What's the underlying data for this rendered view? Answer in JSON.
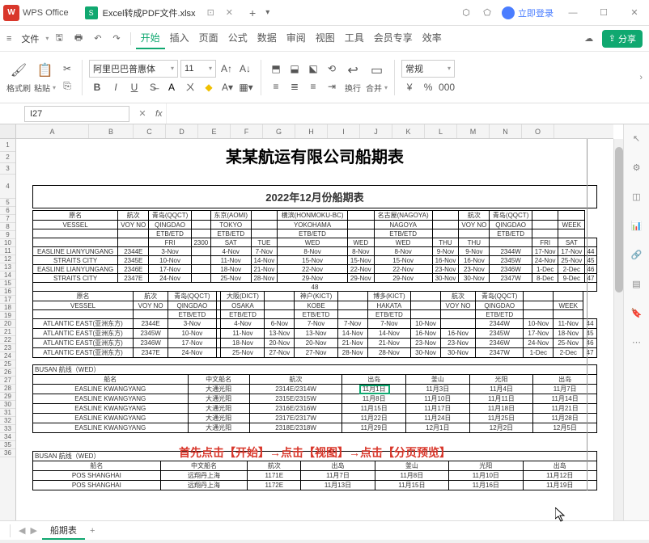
{
  "app": {
    "name": "WPS Office",
    "file_name": "Excel转成PDF文件.xlsx"
  },
  "login": {
    "label": "立即登录"
  },
  "menu": {
    "file": "文件",
    "tabs": [
      "开始",
      "插入",
      "页面",
      "公式",
      "数据",
      "审阅",
      "视图",
      "工具",
      "会员专享",
      "效率"
    ],
    "active": 0
  },
  "share": {
    "label": "分享"
  },
  "ribbon": {
    "format_painter": "格式刷",
    "paste": "粘贴",
    "font": "阿里巴巴普惠体",
    "font_size": "11",
    "wrap": "换行",
    "merge": "合并",
    "normal": "常规"
  },
  "formula": {
    "name_box": "I27",
    "fx": "fx"
  },
  "cols": [
    "A",
    "B",
    "C",
    "D",
    "E",
    "F",
    "G",
    "H",
    "I",
    "J",
    "K",
    "L",
    "M",
    "N",
    "O"
  ],
  "rows_start": 1,
  "rows_end": 36,
  "doc": {
    "title": "某某航运有限公司船期表",
    "subtitle": "2022年12月份船期表"
  },
  "tbl1": {
    "hdr1": [
      "原名",
      "航次",
      "青岛(QQCT)",
      "",
      "东京(AOMI)",
      "",
      "横滨(HONMOKU-BC)",
      "",
      "名古屋(NAGOYA)",
      "",
      "航次",
      "青岛(QQCT)",
      "",
      ""
    ],
    "hdr2": [
      "VESSEL",
      "VOY NO",
      "QINGDAO",
      "",
      "TOKYO",
      "",
      "YOKOHAMA",
      "",
      "NAGOYA",
      "",
      "VOY NO",
      "QINGDAO",
      "",
      "WEEK"
    ],
    "hdr3": [
      "",
      "",
      "ETB/ETD",
      "",
      "ETB/ETD",
      "",
      "ETB/ETD",
      "",
      "ETB/ETD",
      "",
      "",
      "ETB/ETD",
      "",
      ""
    ],
    "hdr4": [
      "",
      "",
      "FRI",
      "2300",
      "SAT",
      "TUE",
      "WED",
      "WED",
      "WED",
      "THU",
      "THU",
      "",
      "FRI",
      "SAT",
      ""
    ],
    "rows": [
      [
        "EASLINE LIANYUNGANG",
        "2344E",
        "3-Nov",
        "",
        "4-Nov",
        "7-Nov",
        "8-Nov",
        "8-Nov",
        "8-Nov",
        "9-Nov",
        "9-Nov",
        "2344W",
        "17-Nov",
        "17-Nov",
        "44"
      ],
      [
        "STRAITS CITY",
        "2345E",
        "10-Nov",
        "",
        "11-Nov",
        "14-Nov",
        "15-Nov",
        "15-Nov",
        "15-Nov",
        "16-Nov",
        "16-Nov",
        "2345W",
        "24-Nov",
        "25-Nov",
        "45"
      ],
      [
        "EASLINE LIANYUNGANG",
        "2346E",
        "17-Nov",
        "",
        "18-Nov",
        "21-Nov",
        "22-Nov",
        "22-Nov",
        "22-Nov",
        "23-Nov",
        "23-Nov",
        "2346W",
        "1-Dec",
        "2-Dec",
        "46"
      ],
      [
        "STRAITS CITY",
        "2347E",
        "24-Nov",
        "",
        "25-Nov",
        "28-Nov",
        "29-Nov",
        "29-Nov",
        "29-Nov",
        "30-Nov",
        "30-Nov",
        "2347W",
        "8-Dec",
        "9-Dec",
        "47"
      ]
    ],
    "footer_num": "48"
  },
  "tbl2": {
    "hdr1": [
      "原名",
      "航次",
      "青岛(QQCT)",
      "",
      "大阪(DICT)",
      "",
      "神户(KICT)",
      "",
      "博多(KICT)",
      "",
      "航次",
      "青岛(QQCT)",
      "",
      ""
    ],
    "hdr2": [
      "VESSEL",
      "VOY NO",
      "QINGDAO",
      "",
      "OSAKA",
      "",
      "KOBE",
      "",
      "HAKATA",
      "",
      "VOY NO",
      "QINGDAO",
      "",
      "WEEK"
    ],
    "hdr3": [
      "",
      "",
      "ETB/ETD",
      "",
      "ETB/ETD",
      "",
      "ETB/ETD",
      "",
      "ETB/ETD",
      "",
      "",
      "ETB/ETD",
      "",
      ""
    ],
    "rows": [
      [
        "ATLANTIC EAST(亚洲东方)",
        "2344E",
        "3-Nov",
        "",
        "4-Nov",
        "6-Nov",
        "7-Nov",
        "7-Nov",
        "7-Nov",
        "10-Nov",
        "",
        "2344W",
        "10-Nov",
        "11-Nov",
        "44"
      ],
      [
        "ATLANTIC EAST(亚洲东方)",
        "2345W",
        "10-Nov",
        "",
        "11-Nov",
        "13-Nov",
        "13-Nov",
        "14-Nov",
        "14-Nov",
        "16-Nov",
        "16-Nov",
        "2345W",
        "17-Nov",
        "18-Nov",
        "45"
      ],
      [
        "ATLANTIC EAST(亚洲东方)",
        "2346W",
        "17-Nov",
        "",
        "18-Nov",
        "20-Nov",
        "20-Nov",
        "21-Nov",
        "21-Nov",
        "23-Nov",
        "23-Nov",
        "2346W",
        "24-Nov",
        "25-Nov",
        "46"
      ],
      [
        "ATLANTIC EAST(亚洲东方)",
        "2347E",
        "24-Nov",
        "",
        "25-Nov",
        "27-Nov",
        "27-Nov",
        "28-Nov",
        "28-Nov",
        "30-Nov",
        "30-Nov",
        "2347W",
        "1-Dec",
        "2-Dec",
        "47"
      ]
    ]
  },
  "tbl3": {
    "title": "BUSAN 航线（WED）",
    "hdr": [
      "船名",
      "中文船名",
      "航次",
      "出岛",
      "釜山",
      "光阳",
      "出岛"
    ],
    "rows": [
      [
        "EASLINE KWANGYANG",
        "大通光阳",
        "2314E/2314W",
        "11月1日",
        "11月3日",
        "11月4日",
        "11月7日"
      ],
      [
        "EASLINE KWANGYANG",
        "大通光阳",
        "2315E/2315W",
        "11月8日",
        "11月10日",
        "11月11日",
        "11月14日"
      ],
      [
        "EASLINE KWANGYANG",
        "大通光阳",
        "2316E/2316W",
        "11月15日",
        "11月17日",
        "11月18日",
        "11月21日"
      ],
      [
        "EASLINE KWANGYANG",
        "大通光阳",
        "2317E/2317W",
        "11月22日",
        "11月24日",
        "11月25日",
        "11月28日"
      ],
      [
        "EASLINE KWANGYANG",
        "大通光阳",
        "2318E/2318W",
        "11月29日",
        "12月1日",
        "12月2日",
        "12月5日"
      ]
    ]
  },
  "tbl4": {
    "title": "BUSAN 航线（WED）",
    "hdr": [
      "船名",
      "中文船名",
      "航次",
      "出岛",
      "釜山",
      "光阳",
      "出岛"
    ],
    "rows": [
      [
        "POS SHANGHAI",
        "远翔丹上海",
        "1171E",
        "11月7日",
        "11月8日",
        "11月10日",
        "11月12日"
      ],
      [
        "POS SHANGHAI",
        "远翔丹上海",
        "1172E",
        "11月13日",
        "11月15日",
        "11月16日",
        "11月19日"
      ]
    ]
  },
  "instruction": "首先点击【开始】→点击【视图】→点击【分页预览】",
  "sheet_tab": "船期表"
}
